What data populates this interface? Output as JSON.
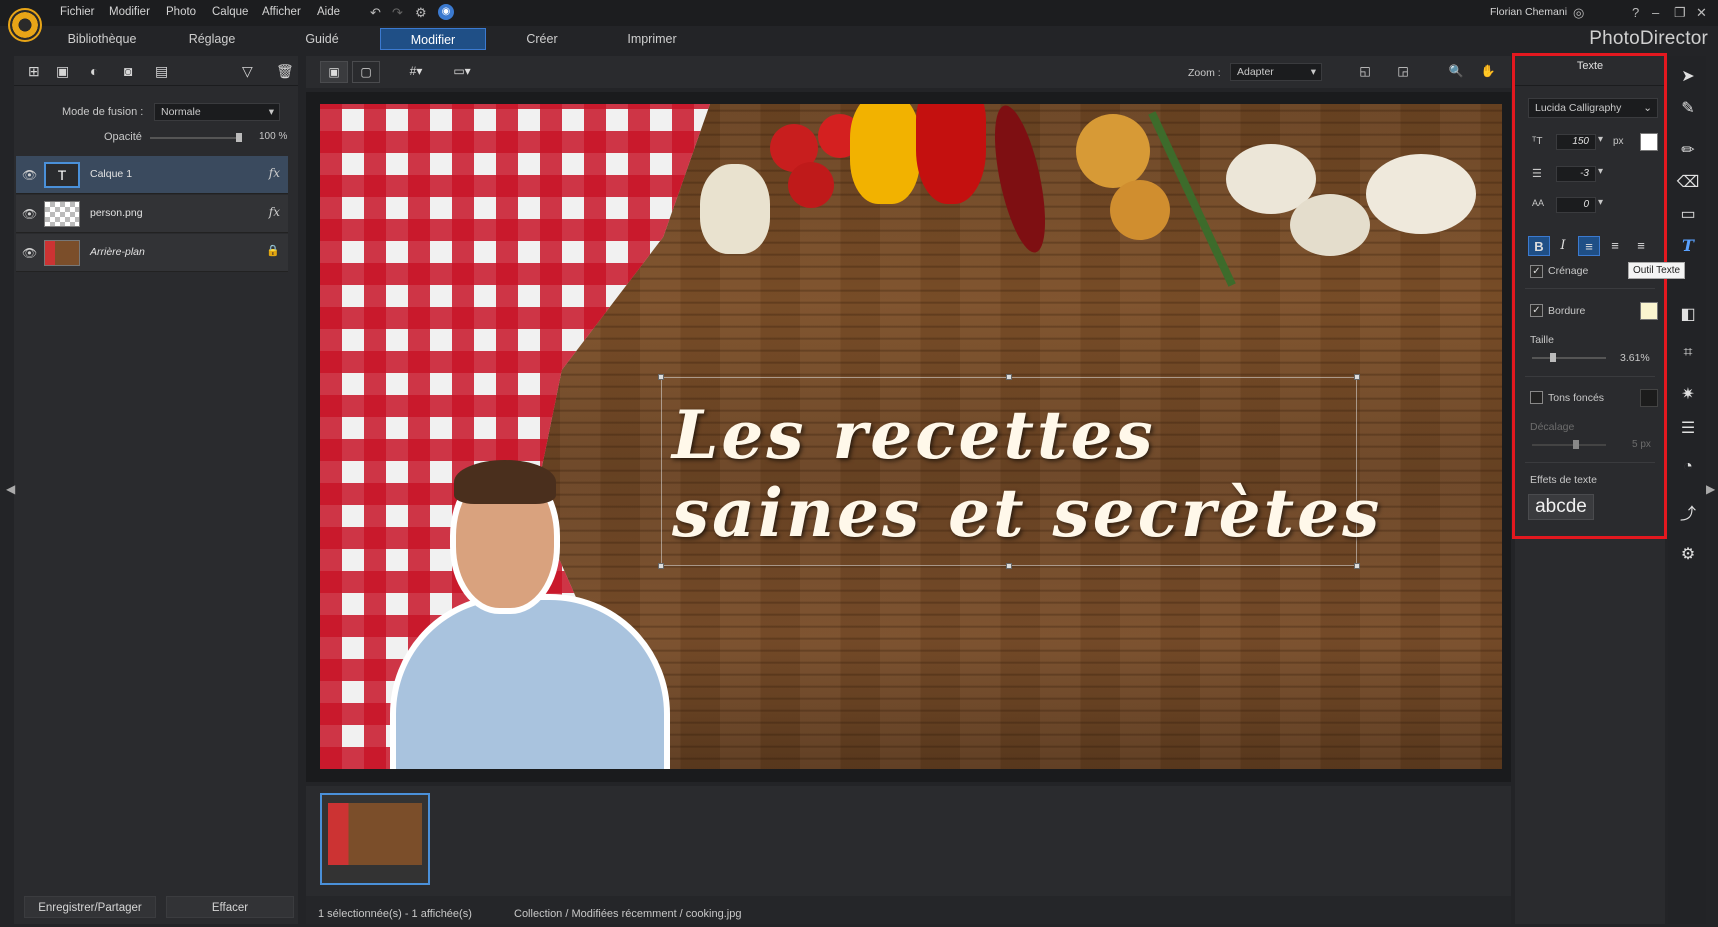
{
  "menu": [
    "Fichier",
    "Modifier",
    "Photo",
    "Calque",
    "Afficher",
    "Aide"
  ],
  "user": "Florian Chemani",
  "window_controls": {
    "help": "?",
    "min": "–",
    "max": "❐",
    "close": "✕"
  },
  "tabs": [
    "Bibliothèque",
    "Réglage",
    "Guidé",
    "Modifier",
    "Créer",
    "Imprimer"
  ],
  "active_tab": "Modifier",
  "brand": "PhotoDirector",
  "layers_panel": {
    "blend_label": "Mode de fusion :",
    "blend_value": "Normale",
    "opacity_label": "Opacité",
    "opacity_value": "100 %",
    "opacity": 1.0,
    "layers": [
      {
        "name": "Calque 1",
        "type": "text",
        "thumb": "T",
        "fx": "fx",
        "selected": true
      },
      {
        "name": "person.png",
        "type": "image",
        "fx": "fx",
        "selected": false
      },
      {
        "name": "Arrière-plan",
        "type": "background",
        "lock": "lock-icon",
        "selected": false
      }
    ]
  },
  "bottom_buttons": {
    "save": "Enregistrer/Partager",
    "clear": "Effacer"
  },
  "zoom": {
    "label": "Zoom :",
    "value": "Adapter"
  },
  "canvas_text": {
    "line1": "Les recettes",
    "line2": "saines et secrètes"
  },
  "status": {
    "selection": "1 sélectionnée(s) - 1 affichée(s)",
    "path": "Collection / Modifiées récemment / cooking.jpg"
  },
  "text_panel": {
    "title": "Texte",
    "font": "Lucida Calligraphy",
    "size": "150",
    "size_unit": "px",
    "line_spacing": "-3",
    "char_spacing": "0",
    "bold": "B",
    "italic": "I",
    "kerning_label": "Crénage",
    "kerning_checked": true,
    "border_label": "Bordure",
    "border_checked": true,
    "size_label": "Taille",
    "size_value": "3.61%",
    "size_fraction": 0.2,
    "shadow_label": "Tons foncés",
    "shadow_checked": false,
    "offset_label": "Décalage",
    "offset_value": "5 px",
    "offset_fraction": 0.4,
    "effects_label": "Effets de texte",
    "effects_sample": "abcde",
    "text_color": "#ffffff",
    "border_color": "#fbf5d0"
  },
  "tooltip": "Outil Texte",
  "colors": {
    "accent": "#1f4f86",
    "highlight_box": "#e3181f"
  }
}
